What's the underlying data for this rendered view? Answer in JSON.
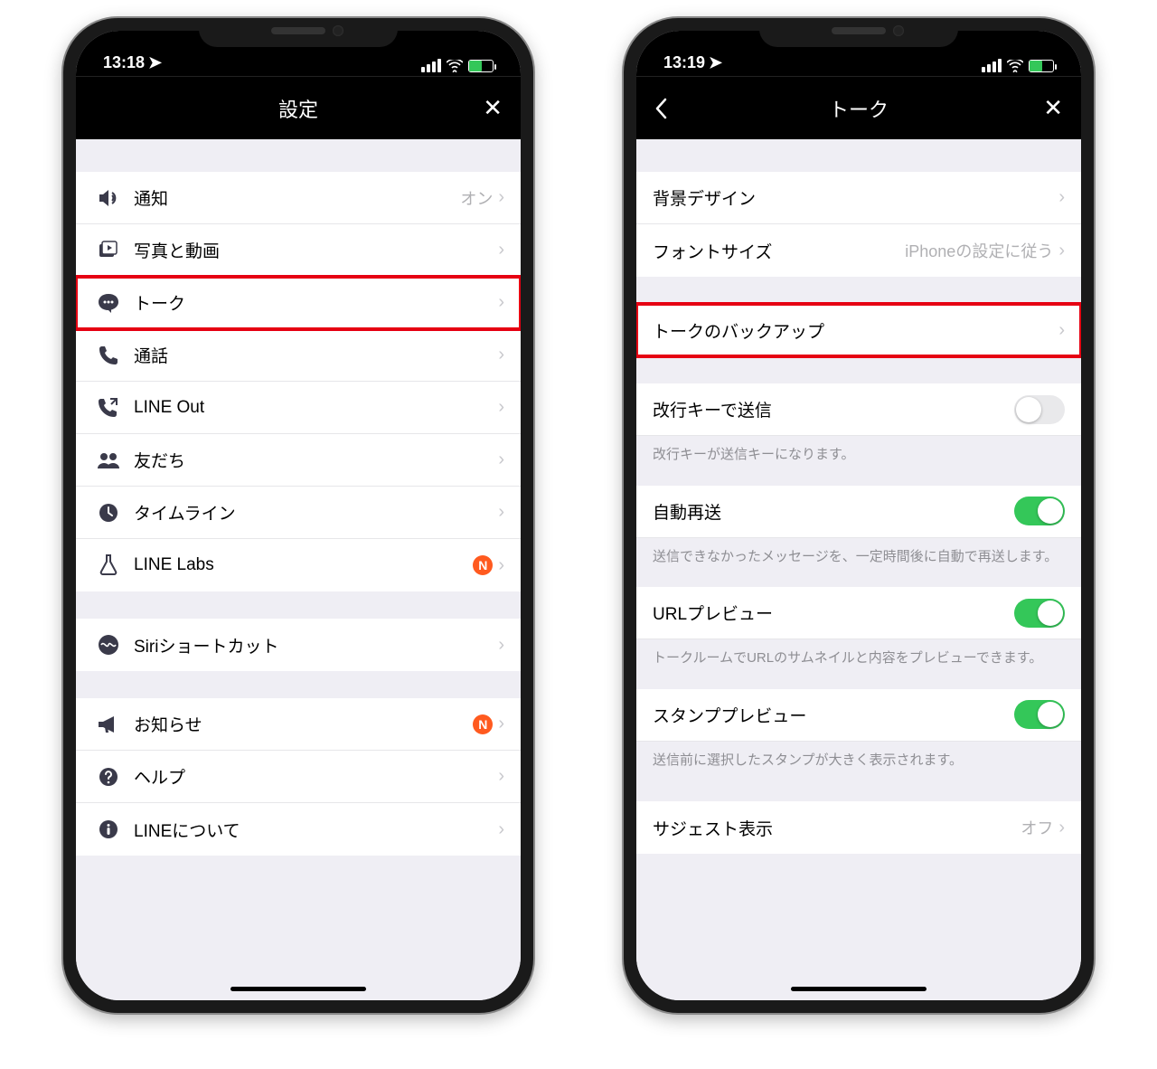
{
  "left": {
    "time": "13:18",
    "title": "設定",
    "rows": [
      {
        "icon": "speaker",
        "label": "通知",
        "value": "オン",
        "badge": false
      },
      {
        "icon": "video-file",
        "label": "写真と動画",
        "value": "",
        "badge": false
      },
      {
        "icon": "chat",
        "label": "トーク",
        "value": "",
        "badge": false,
        "highlight": true
      },
      {
        "icon": "phone",
        "label": "通話",
        "value": "",
        "badge": false
      },
      {
        "icon": "phone-out",
        "label": "LINE Out",
        "value": "",
        "badge": false
      },
      {
        "icon": "people",
        "label": "友だち",
        "value": "",
        "badge": false
      },
      {
        "icon": "clock",
        "label": "タイムライン",
        "value": "",
        "badge": false
      },
      {
        "icon": "flask",
        "label": "LINE Labs",
        "value": "",
        "badge": true
      }
    ],
    "section2": [
      {
        "icon": "siri",
        "label": "Siriショートカット",
        "value": "",
        "badge": false
      }
    ],
    "section3": [
      {
        "icon": "megaphone",
        "label": "お知らせ",
        "value": "",
        "badge": true
      },
      {
        "icon": "help",
        "label": "ヘルプ",
        "value": "",
        "badge": false
      },
      {
        "icon": "info",
        "label": "LINEについて",
        "value": "",
        "badge": false
      }
    ],
    "badgeText": "N"
  },
  "right": {
    "time": "13:19",
    "title": "トーク",
    "section1": [
      {
        "label": "背景デザイン",
        "value": ""
      },
      {
        "label": "フォントサイズ",
        "value": "iPhoneの設定に従う"
      }
    ],
    "section2": [
      {
        "label": "トークのバックアップ",
        "value": "",
        "highlight": true
      }
    ],
    "section3": [
      {
        "label": "改行キーで送信",
        "toggle": "off",
        "footer": "改行キーが送信キーになります。"
      },
      {
        "label": "自動再送",
        "toggle": "on",
        "footer": "送信できなかったメッセージを、一定時間後に自動で再送します。"
      },
      {
        "label": "URLプレビュー",
        "toggle": "on",
        "footer": "トークルームでURLのサムネイルと内容をプレビューできます。"
      },
      {
        "label": "スタンププレビュー",
        "toggle": "on",
        "footer": "送信前に選択したスタンプが大きく表示されます。"
      }
    ],
    "section4": [
      {
        "label": "サジェスト表示",
        "value": "オフ"
      }
    ]
  }
}
